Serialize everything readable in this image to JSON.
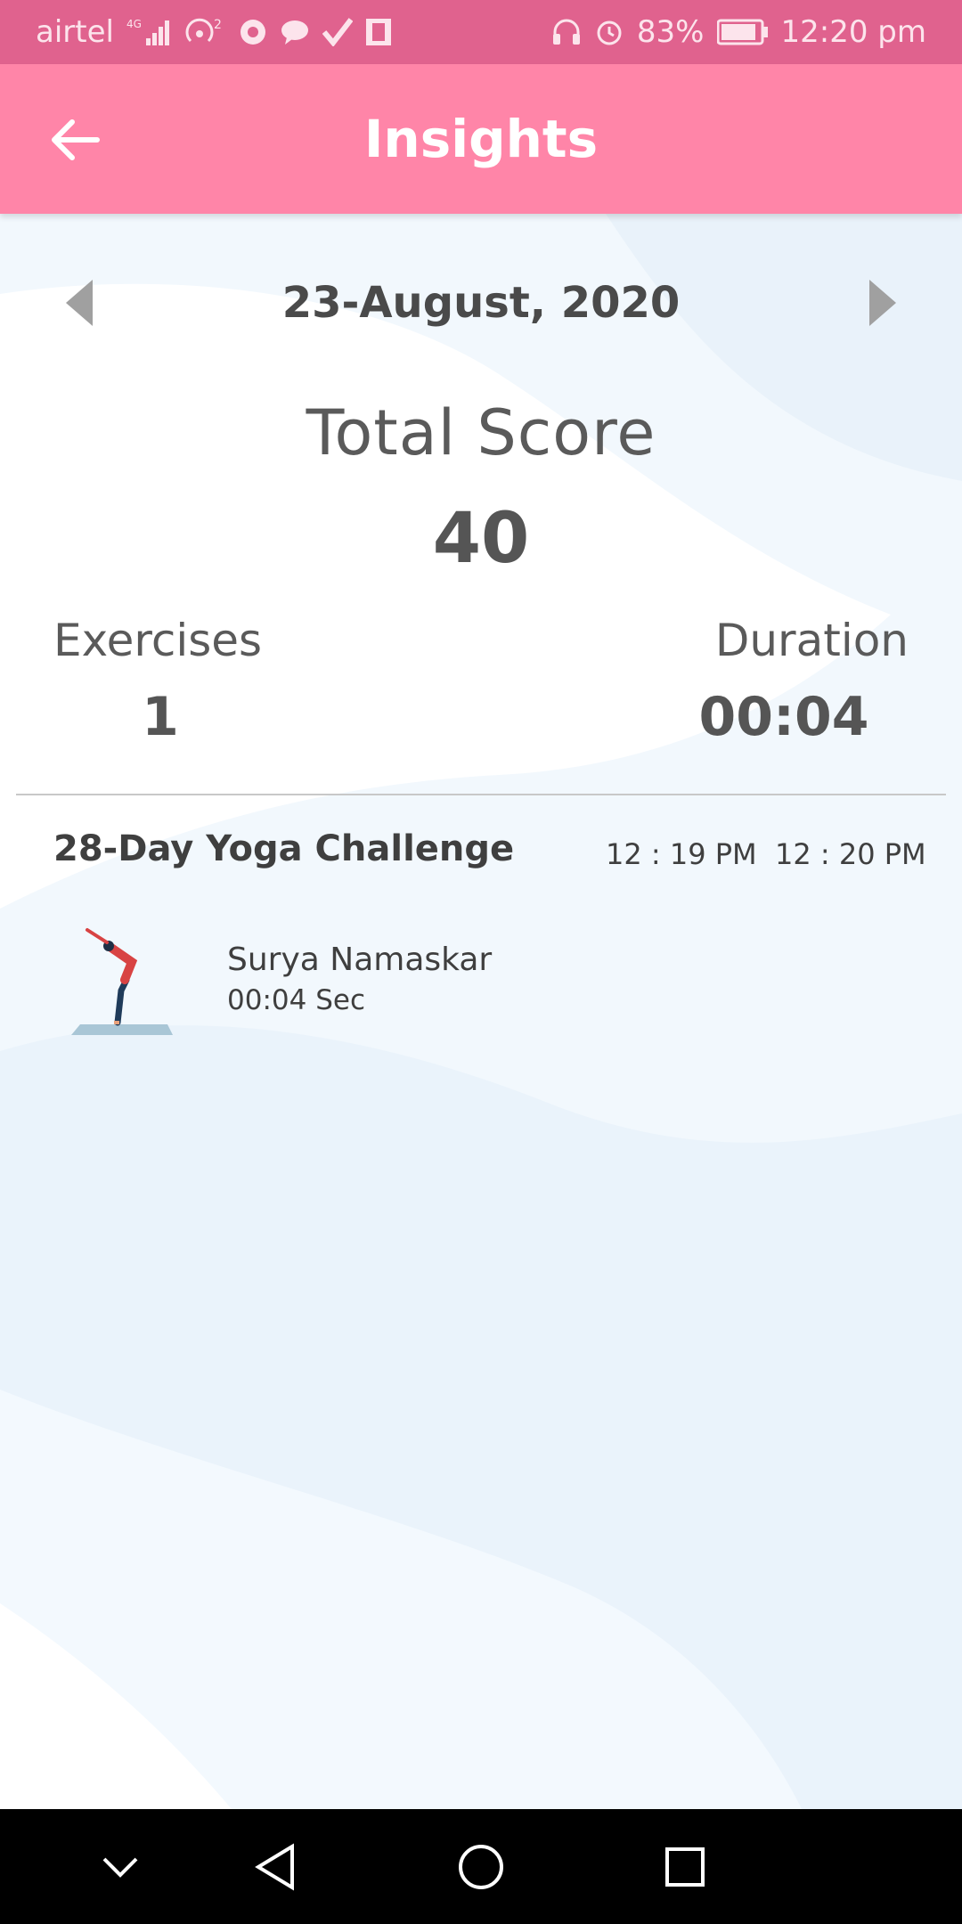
{
  "status_bar": {
    "carrier": "airtel",
    "network": "4G",
    "hotspot_count": "2",
    "battery": "83%",
    "time": "12:20 pm",
    "icons": [
      "signal-icon",
      "hotspot-icon",
      "chrome-icon",
      "message-icon",
      "check-icon",
      "sim-icon",
      "headphones-icon",
      "alarm-icon",
      "battery-icon"
    ]
  },
  "app_bar": {
    "title": "Insights",
    "back_icon": "arrow-left-icon"
  },
  "date_nav": {
    "date": "23-August, 2020",
    "prev_icon": "triangle-left-icon",
    "next_icon": "triangle-right-icon"
  },
  "summary": {
    "score_label": "Total Score",
    "score_value": "40",
    "exercises_label": "Exercises",
    "exercises_value": "1",
    "duration_label": "Duration",
    "duration_value": "00:04"
  },
  "session": {
    "title": "28-Day Yoga Challenge",
    "start_time": "12 : 19 PM",
    "end_time": "12 : 20 PM",
    "exercises": [
      {
        "name": "Surya Namaskar",
        "duration": "00:04 Sec",
        "icon": "yoga-pose-icon"
      }
    ]
  },
  "nav_bar": {
    "icons": [
      "chevron-down-icon",
      "back-triangle-icon",
      "home-circle-icon",
      "recents-square-icon"
    ]
  },
  "colors": {
    "status_bar": "#e0628e",
    "app_bar": "#ff85a8",
    "background_wave": "#eaf3fb",
    "text_dark": "#4a4a4a"
  }
}
